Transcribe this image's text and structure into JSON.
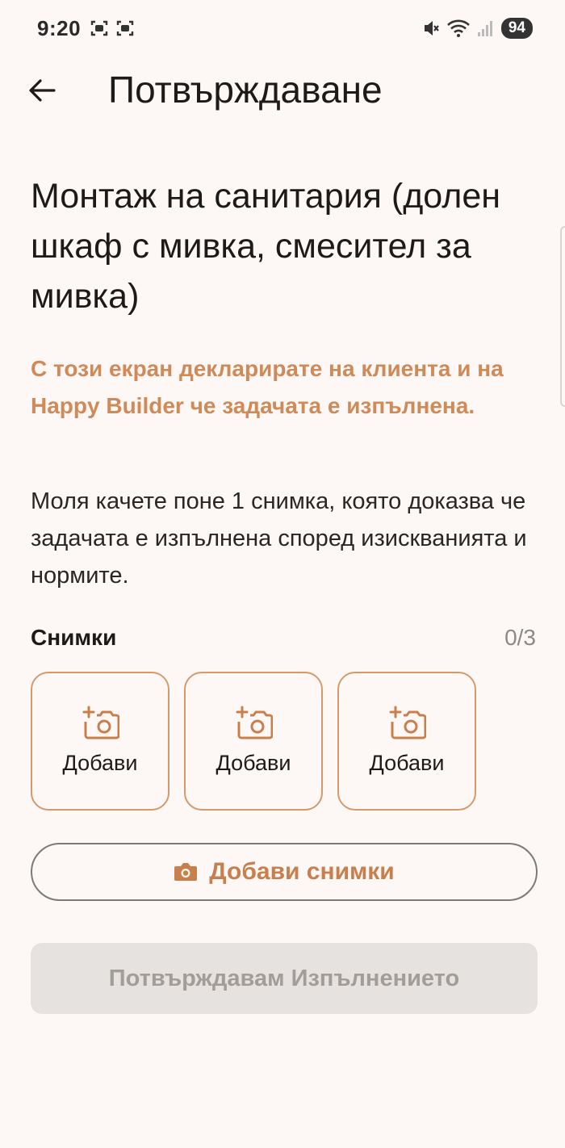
{
  "status_bar": {
    "time": "9:20",
    "battery": "94"
  },
  "app_bar": {
    "title": "Потвърждаване"
  },
  "task": {
    "title": "Монтаж на санитария (долен шкаф с мивка, смесител за мивка)"
  },
  "notice": "С този екран декларирате на клиента и на Happy Builder че задачата е изпълнена.",
  "instructions": "Моля качете поне 1 снимка, която доказва че задачата е изпълнена според изискванията и нормите.",
  "photos": {
    "label": "Снимки",
    "count": "0/3",
    "slots": [
      {
        "label": "Добави"
      },
      {
        "label": "Добави"
      },
      {
        "label": "Добави"
      }
    ]
  },
  "add_photos_button": {
    "label": "Добави снимки",
    "icon": "camera-icon"
  },
  "confirm_button": {
    "label": "Потвърждавам Изпълнението",
    "enabled": false
  },
  "colors": {
    "accent": "#cf8a58",
    "background": "#fdf8f6",
    "disabled_bg": "#e6e2df",
    "disabled_text": "#a29d99"
  }
}
